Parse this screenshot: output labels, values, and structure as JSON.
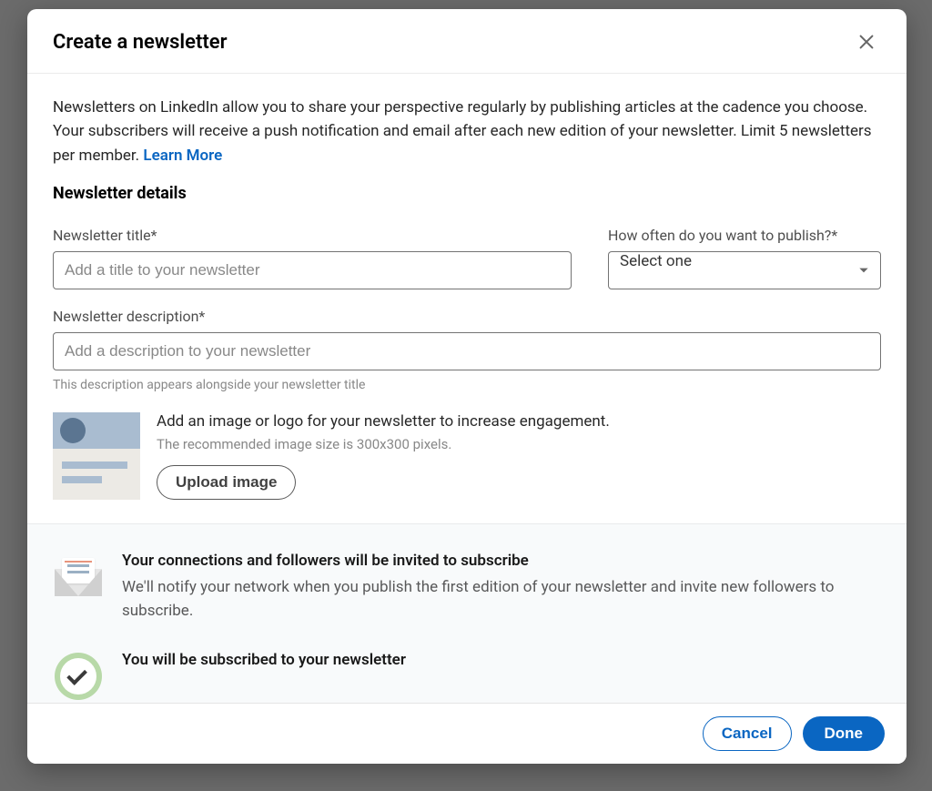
{
  "header": {
    "title": "Create a newsletter"
  },
  "intro": {
    "text": "Newsletters on LinkedIn allow you to share your perspective regularly by publishing articles at the cadence you choose. Your subscribers will receive a push notification and email after each new edition of your newsletter. Limit 5 newsletters per member. ",
    "learn_more": "Learn More"
  },
  "details": {
    "heading": "Newsletter details",
    "title_field": {
      "label": "Newsletter title*",
      "placeholder": "Add a title to your newsletter",
      "value": ""
    },
    "frequency_field": {
      "label": "How often do you want to publish?*",
      "selected": "Select one"
    },
    "description_field": {
      "label": "Newsletter description*",
      "placeholder": "Add a description to your newsletter",
      "value": "",
      "help": "This description appears alongside your newsletter title"
    },
    "upload": {
      "title": "Add an image or logo for your newsletter to increase engagement.",
      "sub": "The recommended image size is 300x300 pixels.",
      "button": "Upload image"
    }
  },
  "info": {
    "item1": {
      "title": "Your connections and followers will be invited to subscribe",
      "text": "We'll notify your network when you publish the first edition of your newsletter and invite new followers to subscribe."
    },
    "item2": {
      "title": "You will be subscribed to your newsletter"
    }
  },
  "footer": {
    "cancel": "Cancel",
    "done": "Done"
  }
}
